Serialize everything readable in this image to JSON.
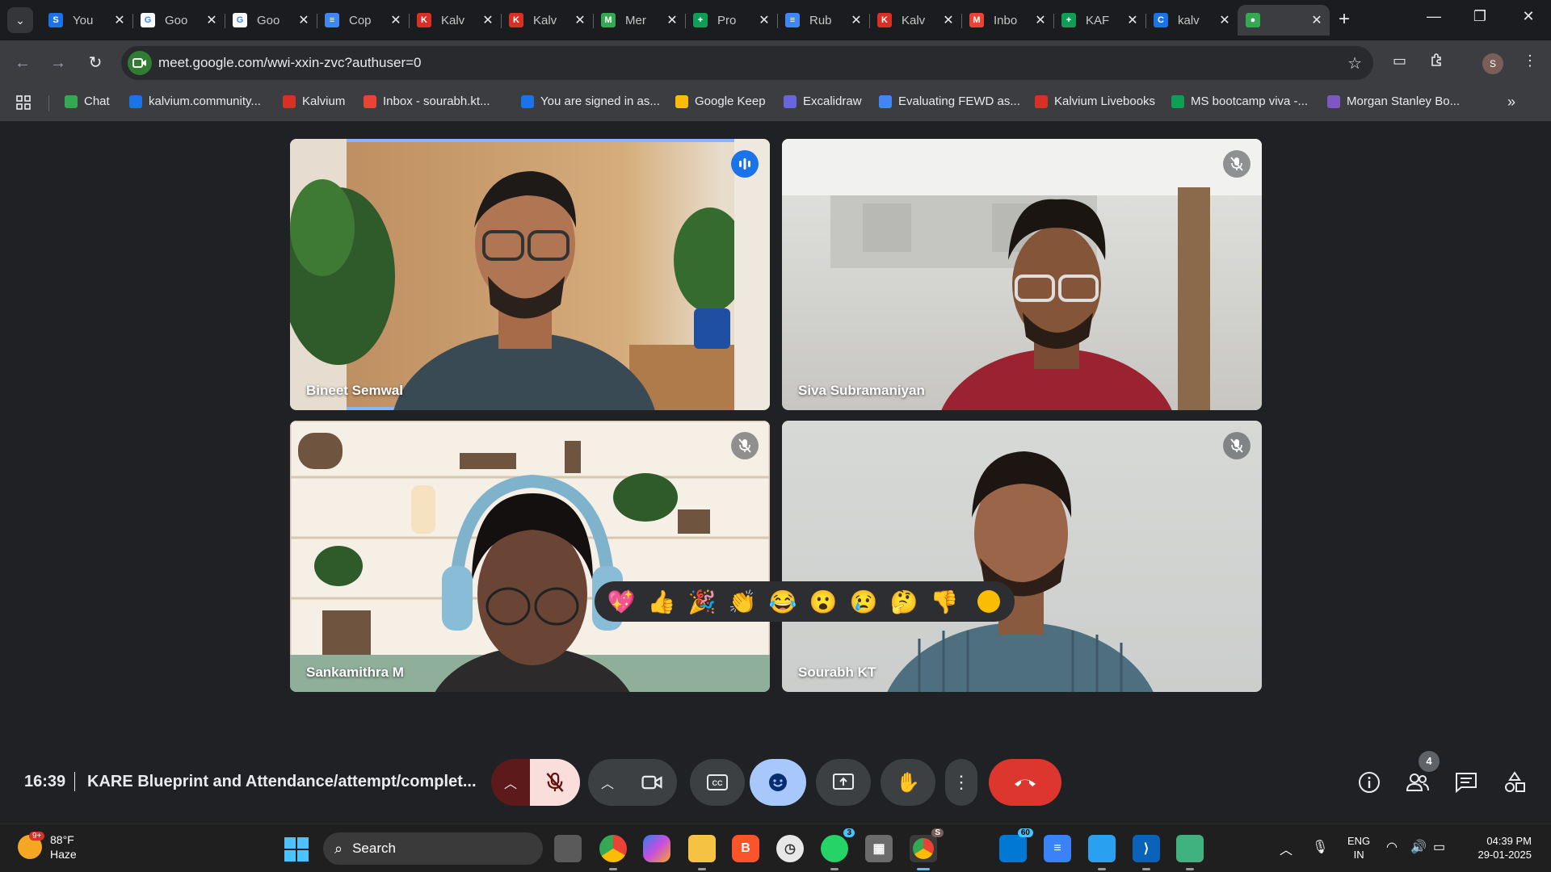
{
  "browser": {
    "tabs": [
      {
        "title": "You",
        "fav_color": "#1a73e8",
        "fav_letter": "S"
      },
      {
        "title": "Goo",
        "fav_color": "#ffffff",
        "fav_letter": "G"
      },
      {
        "title": "Goo",
        "fav_color": "#ffffff",
        "fav_letter": "G"
      },
      {
        "title": "Cop",
        "fav_color": "#4285f4",
        "fav_letter": "≡"
      },
      {
        "title": "Kalv",
        "fav_color": "#d93025",
        "fav_letter": "K"
      },
      {
        "title": "Kalv",
        "fav_color": "#d93025",
        "fav_letter": "K"
      },
      {
        "title": "Mer",
        "fav_color": "#34a853",
        "fav_letter": "M"
      },
      {
        "title": "Pro",
        "fav_color": "#0f9d58",
        "fav_letter": "+"
      },
      {
        "title": "Rub",
        "fav_color": "#4285f4",
        "fav_letter": "≡"
      },
      {
        "title": "Kalv",
        "fav_color": "#d93025",
        "fav_letter": "K"
      },
      {
        "title": "Inbo",
        "fav_color": "#ea4335",
        "fav_letter": "M"
      },
      {
        "title": "KAF",
        "fav_color": "#0f9d58",
        "fav_letter": "+"
      },
      {
        "title": "kalv",
        "fav_color": "#1a73e8",
        "fav_letter": "C"
      },
      {
        "title": "",
        "fav_color": "#34a853",
        "fav_letter": "●"
      }
    ],
    "url": "meet.google.com/wwi-xxin-zvc?authuser=0",
    "profile_initial": "S",
    "bookmarks": [
      {
        "label": "Chat",
        "fav_color": "#34a853"
      },
      {
        "label": "kalvium.community...",
        "fav_color": "#1a73e8"
      },
      {
        "label": "Kalvium",
        "fav_color": "#d93025"
      },
      {
        "label": "Inbox - sourabh.kt...",
        "fav_color": "#ea4335"
      },
      {
        "label": "You are signed in as...",
        "fav_color": "#1a73e8"
      },
      {
        "label": "Google Keep",
        "fav_color": "#fbbc04"
      },
      {
        "label": "Excalidraw",
        "fav_color": "#6965db"
      },
      {
        "label": "Evaluating FEWD as...",
        "fav_color": "#4285f4"
      },
      {
        "label": "Kalvium Livebooks",
        "fav_color": "#d93025"
      },
      {
        "label": "MS bootcamp viva -...",
        "fav_color": "#0f9d58"
      },
      {
        "label": "Morgan Stanley Bo...",
        "fav_color": "#7e57c2"
      }
    ]
  },
  "meet": {
    "participants": [
      {
        "name": "Bineet Semwal",
        "status": "speaking"
      },
      {
        "name": "Siva Subramaniyan",
        "status": "muted"
      },
      {
        "name": "Sankamithra M",
        "status": "muted"
      },
      {
        "name": "Sourabh KT",
        "status": "muted"
      }
    ],
    "reactions": [
      "💖",
      "👍",
      "🎉",
      "👏",
      "😂",
      "😮",
      "😢",
      "🤔",
      "👎"
    ],
    "time": "16:39",
    "meeting_title": "KARE Blueprint and Attendance/attempt/complet...",
    "people_count": "4"
  },
  "taskbar": {
    "weather_temp": "88°F",
    "weather_desc": "Haze",
    "weather_badge": "9+",
    "search_label": "Search",
    "chrome_badge": "S",
    "whatsapp_badge": "3",
    "outlook_badge": "60",
    "lang_top": "ENG",
    "lang_bottom": "IN",
    "time": "04:39 PM",
    "date": "29-01-2025"
  }
}
